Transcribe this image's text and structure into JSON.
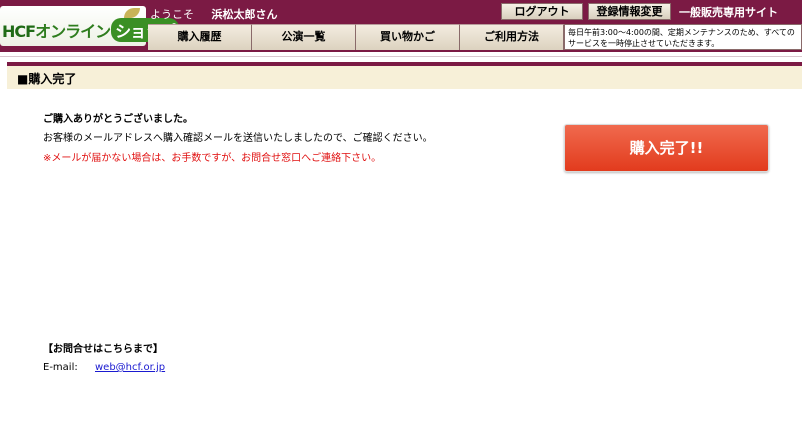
{
  "header": {
    "logo": {
      "hcf": "HCF",
      "online": "オンライン",
      "shop": "ショップ"
    },
    "welcome": "ようこそ",
    "user_name": "浜松太郎さん",
    "logout_label": "ログアウト",
    "register_label": "登録情報変更",
    "site_label": "一般販売専用サイト",
    "nav": [
      {
        "label": "購入履歴"
      },
      {
        "label": "公演一覧"
      },
      {
        "label": "買い物かご"
      },
      {
        "label": "ご利用方法"
      }
    ],
    "notice": "毎日午前3:00〜4:00の間、定期メンテナンスのため、すべてのサービスを一時停止させていただきます。"
  },
  "section": {
    "title": "■購入完了"
  },
  "main": {
    "thanks": "ご購入ありがとうございました。",
    "mail_sent": "お客様のメールアドレスへ購入確認メールを送信いたしましたので、ご確認ください。",
    "warning": "※メールが届かない場合は、お手数ですが、お問合せ窓口へご連絡下さい。",
    "done_button": "購入完了!!"
  },
  "contact": {
    "title": "【お問合せはこちらまで】",
    "email_label": "E-mail:",
    "email": "web@hcf.or.jp"
  },
  "colors": {
    "header_bg": "#7b1a44",
    "section_bg": "#f7f0d8",
    "button_red": "#e23b1d",
    "warning_red": "#e01010",
    "link_blue": "#1a1ad0"
  }
}
